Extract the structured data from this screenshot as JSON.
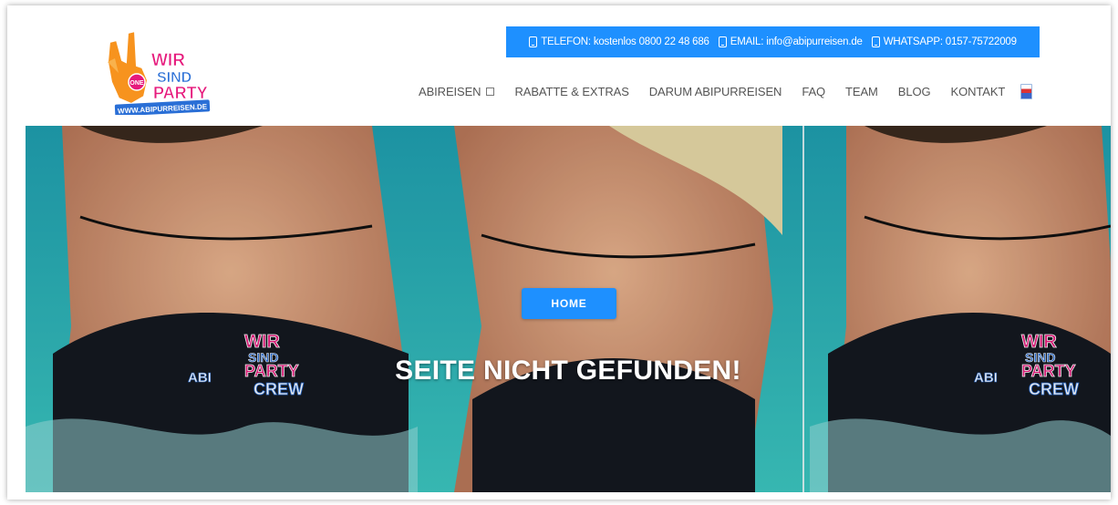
{
  "logo": {
    "line1": "WIR",
    "line2": "SIND",
    "line3": "PARTY",
    "url": "WWW.ABIPURREISEN.DE",
    "badge": "ONE"
  },
  "contact": {
    "phone": "TELEFON: kostenlos 0800 22 48 686",
    "email": "EMAIL: info@abipurreisen.de",
    "whatsapp": "WHATSAPP: 0157-75722009"
  },
  "nav": {
    "items": [
      {
        "label": "ABIREISEN"
      },
      {
        "label": "RABATTE & EXTRAS"
      },
      {
        "label": "DARUM ABIPURREISEN"
      },
      {
        "label": "FAQ"
      },
      {
        "label": "TEAM"
      },
      {
        "label": "BLOG"
      },
      {
        "label": "KONTAKT"
      }
    ]
  },
  "hero": {
    "title": "SEITE NICHT GEFUNDEN!",
    "button": "HOME",
    "print_line1": "WIR",
    "print_line2": "SIND",
    "print_line3": "PARTY",
    "print_line4": "ABI",
    "print_line5": "CREW"
  },
  "colors": {
    "accent": "#1e90ff",
    "logo_pink": "#e6197c",
    "logo_blue": "#2a6fd6",
    "logo_orange": "#f7931e"
  }
}
